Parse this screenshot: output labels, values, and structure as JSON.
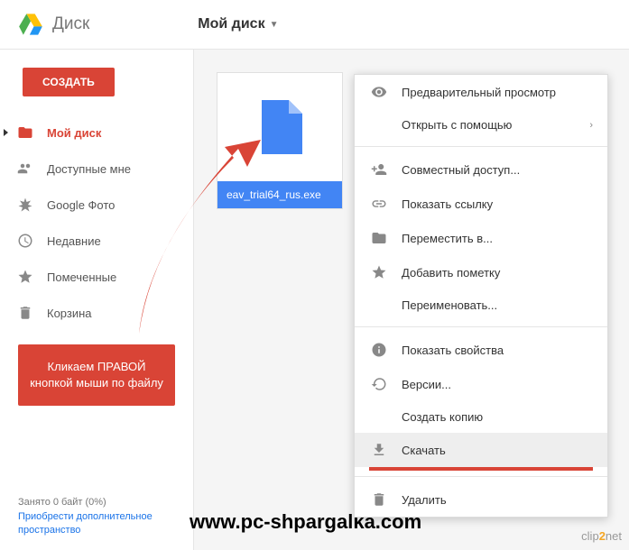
{
  "header": {
    "title": "Диск",
    "breadcrumb": "Мой диск"
  },
  "sidebar": {
    "create_label": "СОЗДАТЬ",
    "items": [
      {
        "label": "Мой диск"
      },
      {
        "label": "Доступные мне"
      },
      {
        "label": "Google Фото"
      },
      {
        "label": "Недавние"
      },
      {
        "label": "Помеченные"
      },
      {
        "label": "Корзина"
      }
    ],
    "callout": "Кликаем ПРАВОЙ кнопкой мыши по файлу",
    "storage_text": "Занято 0 байт (0%)",
    "storage_link": "Приобрести дополнительное пространство"
  },
  "file": {
    "name": "eav_trial64_rus.exe"
  },
  "context_menu": {
    "preview": "Предварительный просмотр",
    "open_with": "Открыть с помощью",
    "share": "Совместный доступ...",
    "get_link": "Показать ссылку",
    "move_to": "Переместить в...",
    "add_star": "Добавить пометку",
    "rename": "Переименовать...",
    "details": "Показать свойства",
    "versions": "Версии...",
    "make_copy": "Создать копию",
    "download": "Скачать",
    "delete": "Удалить"
  },
  "watermark": "www.pc-shpargalka.com",
  "clip2net": {
    "p1": "clip",
    "p2": "2",
    "p3": "net"
  }
}
